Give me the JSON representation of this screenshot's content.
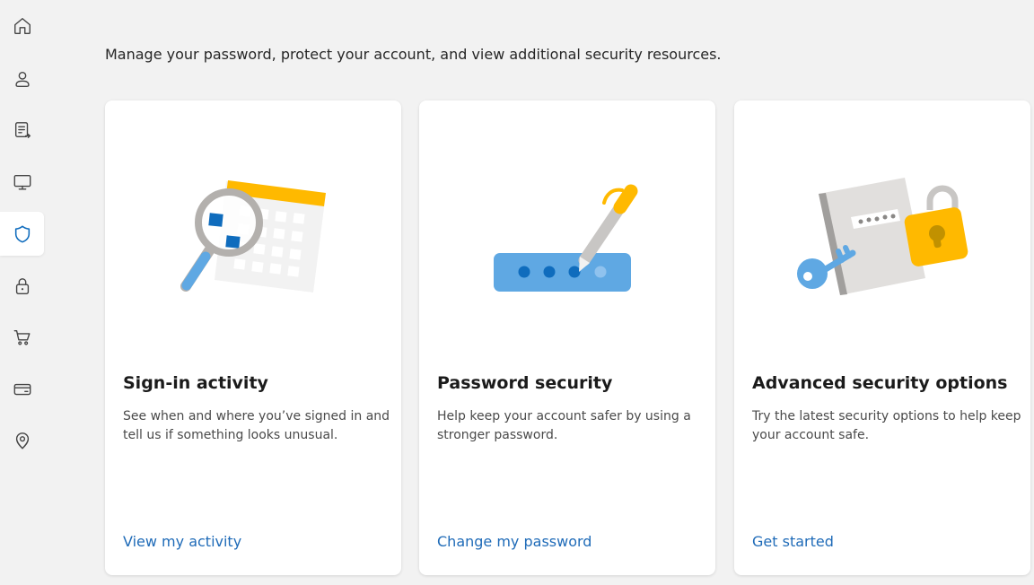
{
  "sidebar": {
    "items": [
      {
        "id": "home",
        "icon": "home-icon"
      },
      {
        "id": "profile",
        "icon": "person-icon"
      },
      {
        "id": "privacy",
        "icon": "document-icon"
      },
      {
        "id": "devices",
        "icon": "monitor-icon"
      },
      {
        "id": "security",
        "icon": "shield-icon",
        "active": true
      },
      {
        "id": "password",
        "icon": "lock-icon"
      },
      {
        "id": "shopping",
        "icon": "cart-icon"
      },
      {
        "id": "payment",
        "icon": "credit-card-icon"
      },
      {
        "id": "location",
        "icon": "location-pin-icon"
      }
    ]
  },
  "main": {
    "intro": "Manage your password, protect your account, and view additional security resources.",
    "cards": [
      {
        "title": "Sign-in activity",
        "description": "See when and where you’ve signed in and tell us if something looks unusual.",
        "link": "View my activity",
        "illustration": "magnifier-calendar-illustration"
      },
      {
        "title": "Password security",
        "description": "Help keep your account safer by using a stronger password.",
        "link": "Change my password",
        "illustration": "password-pen-illustration"
      },
      {
        "title": "Advanced security options",
        "description": "Try the latest security options to help keep your account safe.",
        "link": "Get started",
        "illustration": "key-lock-illustration"
      }
    ]
  },
  "colors": {
    "background": "#f2f2f2",
    "card": "#ffffff",
    "link": "#1f6bb8",
    "icon": "#444444",
    "accent_yellow": "#ffb900",
    "accent_blue": "#5fa8e3",
    "accent_dark_blue": "#0f6cbd"
  }
}
